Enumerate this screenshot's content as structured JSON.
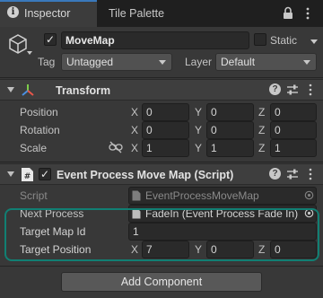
{
  "tabs": {
    "inspector": "Inspector",
    "tile_palette": "Tile Palette"
  },
  "gameobject": {
    "name": "MoveMap",
    "static_label": "Static",
    "tag_label": "Tag",
    "tag_value": "Untagged",
    "layer_label": "Layer",
    "layer_value": "Default"
  },
  "transform": {
    "title": "Transform",
    "rows": [
      {
        "label": "Position",
        "x": "0",
        "y": "0",
        "z": "0"
      },
      {
        "label": "Rotation",
        "x": "0",
        "y": "0",
        "z": "0"
      },
      {
        "label": "Scale",
        "x": "1",
        "y": "1",
        "z": "1"
      }
    ]
  },
  "axes": {
    "x": "X",
    "y": "Y",
    "z": "Z"
  },
  "script_component": {
    "title": "Event Process Move Map (Script)",
    "script_label": "Script",
    "script_value": "EventProcessMoveMap",
    "next_label": "Next Process",
    "next_value": "FadeIn (Event Process Fade In)",
    "map_id_label": "Target Map Id",
    "map_id_value": "1",
    "position_label": "Target Position",
    "pos_x": "7",
    "pos_y": "0",
    "pos_z": "0"
  },
  "add_component": "Add Component",
  "colors": {
    "highlight": "#117f73",
    "accent_tab": "#3a79bb",
    "background": "#383838"
  }
}
